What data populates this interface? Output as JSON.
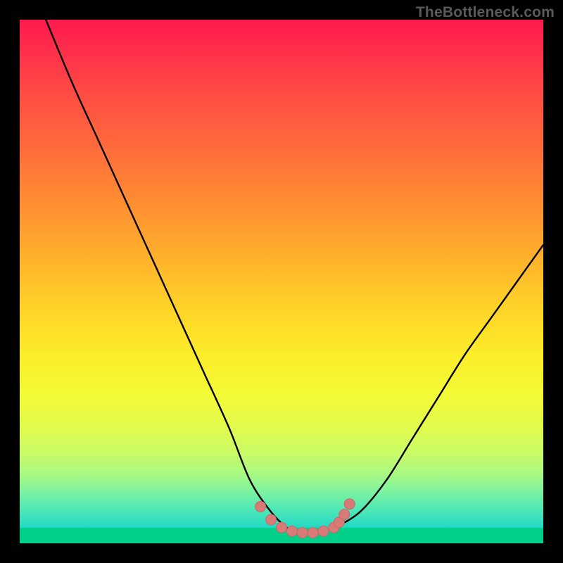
{
  "watermark": "TheBottleneck.com",
  "colors": {
    "frame": "#000000",
    "watermark_text": "#5a5a5a",
    "curve_stroke": "#000000",
    "marker_fill": "#d87a78",
    "marker_stroke": "#c96865",
    "green_band": "#00D08A"
  },
  "chart_data": {
    "type": "line",
    "title": "",
    "xlabel": "",
    "ylabel": "",
    "xlim": [
      0,
      100
    ],
    "ylim": [
      0,
      100
    ],
    "grid": false,
    "legend": false,
    "series": [
      {
        "name": "bottleneck-curve",
        "x": [
          5,
          10,
          15,
          20,
          25,
          30,
          35,
          40,
          44,
          48,
          51,
          53,
          56,
          60,
          65,
          70,
          75,
          80,
          85,
          90,
          95,
          100
        ],
        "values": [
          100,
          88,
          77,
          66,
          55,
          44,
          33,
          22,
          12,
          6,
          3,
          2,
          2,
          3,
          6,
          12,
          20,
          28,
          36,
          43,
          50,
          57
        ]
      }
    ],
    "markers": {
      "name": "highlight-range",
      "x": [
        46,
        48,
        50,
        52,
        54,
        56,
        58,
        60,
        61,
        62,
        63
      ],
      "values": [
        7.0,
        4.5,
        3.0,
        2.3,
        2.0,
        2.0,
        2.3,
        3.0,
        4.0,
        5.5,
        7.5
      ]
    }
  }
}
